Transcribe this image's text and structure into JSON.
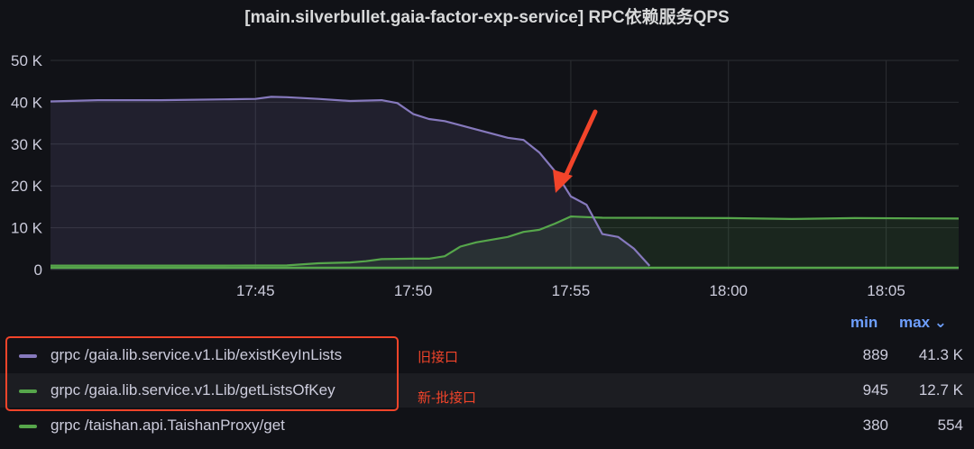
{
  "title": "[main.silverbullet.gaia-factor-exp-service] RPC依赖服务QPS",
  "chart_data": {
    "type": "area",
    "title": "[main.silverbullet.gaia-factor-exp-service] RPC依赖服务QPS",
    "y_ticks": [
      "0",
      "10 K",
      "20 K",
      "30 K",
      "40 K",
      "50 K"
    ],
    "ylim": [
      0,
      50000
    ],
    "x_ticks": [
      "17:45",
      "17:50",
      "17:55",
      "18:00",
      "18:05"
    ],
    "x_tick_minutes": [
      45,
      50,
      55,
      60,
      65
    ],
    "xlim_minutes": [
      38.5,
      67.3
    ],
    "grid": true,
    "series": [
      {
        "name": "grpc /gaia.lib.service.v1.Lib/existKeyInLists",
        "color": "#8679bd",
        "x": [
          38.5,
          40,
          42,
          44,
          45,
          45.5,
          46,
          47,
          48,
          49,
          49.5,
          50,
          50.5,
          51,
          52,
          53,
          53.5,
          54,
          54.5,
          55,
          55.5,
          56,
          56.5,
          57,
          57.5
        ],
        "y": [
          40200,
          40500,
          40500,
          40700,
          40800,
          41300,
          41200,
          40800,
          40300,
          40500,
          39800,
          37200,
          36000,
          35500,
          33500,
          31500,
          31000,
          28000,
          23500,
          17500,
          15500,
          8500,
          7800,
          5000,
          889
        ]
      },
      {
        "name": "grpc /gaia.lib.service.v1.Lib/getListsOfKey",
        "color": "#56a64b",
        "x": [
          38.5,
          44,
          46,
          47,
          48,
          48.5,
          49,
          50,
          50.5,
          51,
          51.5,
          52,
          53,
          53.5,
          54,
          54.5,
          55,
          56,
          60,
          62,
          64,
          67.3
        ],
        "y": [
          945,
          950,
          1000,
          1500,
          1700,
          2000,
          2500,
          2600,
          2600,
          3200,
          5500,
          6500,
          7800,
          9000,
          9500,
          11000,
          12700,
          12400,
          12300,
          12100,
          12300,
          12200
        ]
      },
      {
        "name": "grpc /taishan.api.TaishanProxy/get",
        "color": "#56a64b",
        "x": [
          38.5,
          67.3
        ],
        "y": [
          450,
          450
        ]
      }
    ],
    "legend": {
      "columns": [
        "min",
        "max"
      ],
      "rows": [
        {
          "name": "grpc /gaia.lib.service.v1.Lib/existKeyInLists",
          "min": "889",
          "max": "41.3 K"
        },
        {
          "name": "grpc /gaia.lib.service.v1.Lib/getListsOfKey",
          "min": "945",
          "max": "12.7 K"
        },
        {
          "name": "grpc /taishan.api.TaishanProxy/get",
          "min": "380",
          "max": "554"
        }
      ]
    }
  },
  "legend_header": {
    "min": "min",
    "max": "max ⌄"
  },
  "annotations": {
    "old_api": "旧接口",
    "new_api": "新-批接口"
  },
  "colors": {
    "accent": "#6e9fff",
    "annotation": "#f2442a"
  }
}
